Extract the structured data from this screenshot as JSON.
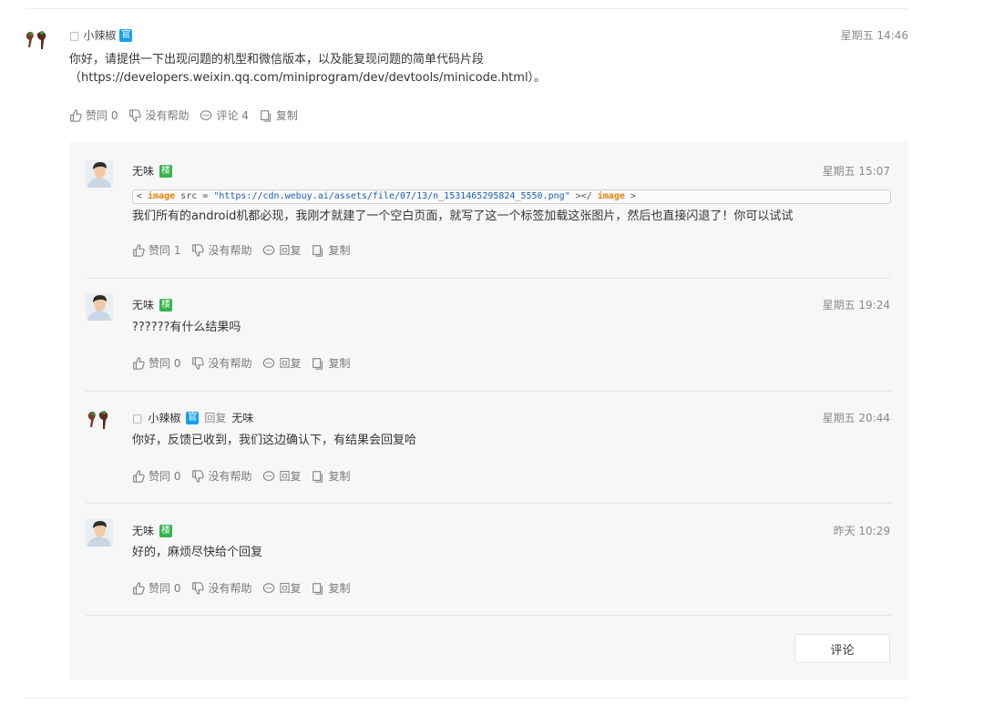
{
  "post": {
    "author": "小辣椒",
    "author_prefix": "□",
    "official_badge": "官",
    "time": "星期五 14:46",
    "body": "你好，请提供一下出现问题的机型和微信版本，以及能复现问题的简单代码片段",
    "link_line": "（https://developers.weixin.qq.com/miniprogram/dev/devtools/minicode.html）。",
    "actions": {
      "like": "赞同 0",
      "unhelpful": "没有帮助",
      "comment": "评论 4",
      "copy": "复制"
    }
  },
  "replies": [
    {
      "author": "无味",
      "badge": "楼",
      "time": "星期五 15:07",
      "code": {
        "open": "< ",
        "tag": "image",
        "attr": " src = ",
        "value": "\"https://cdn.webuy.ai/assets/file/07/13/n_1531465295824_5550.png\"",
        "mid": " ></ ",
        "close_tag": "image",
        "end": " >"
      },
      "text": "我们所有的android机都必现，我刚才就建了一个空白页面，就写了这一个标签加载这张图片，然后也直接闪退了！你可以试试",
      "actions": {
        "like": "赞同 1",
        "unhelpful": "没有帮助",
        "reply": "回复",
        "copy": "复制"
      }
    },
    {
      "author": "无味",
      "badge": "楼",
      "time": "星期五 19:24",
      "text": "??????有什么结果吗",
      "actions": {
        "like": "赞同 0",
        "unhelpful": "没有帮助",
        "reply": "回复",
        "copy": "复制"
      }
    },
    {
      "author": "小辣椒",
      "author_prefix": "□",
      "badge": "官",
      "reply_label": "回复",
      "reply_to": "无味",
      "time": "星期五 20:44",
      "text": "你好，反馈已收到，我们这边确认下，有结果会回复哈",
      "actions": {
        "like": "赞同 0",
        "unhelpful": "没有帮助",
        "reply": "回复",
        "copy": "复制"
      }
    },
    {
      "author": "无味",
      "badge": "楼",
      "time": "昨天 10:29",
      "text": "好的，麻烦尽快给个回复",
      "actions": {
        "like": "赞同 0",
        "unhelpful": "没有帮助",
        "reply": "回复",
        "copy": "复制"
      }
    }
  ],
  "comment_button": "评论",
  "colors": {
    "official_badge": "#1aa0e8",
    "floor_badge": "#35b44a",
    "panel_bg": "#f7f7f7",
    "code_tag": "#e5830b",
    "code_string": "#1a5fb4"
  }
}
